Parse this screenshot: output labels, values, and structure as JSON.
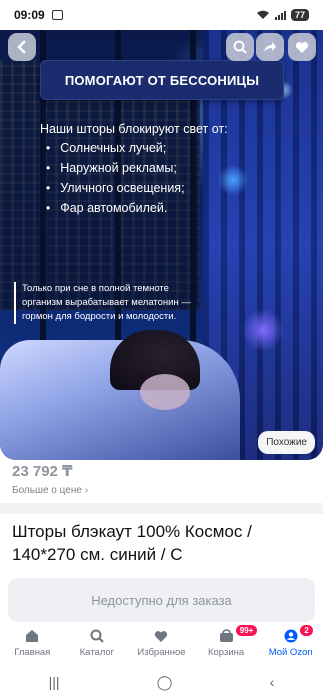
{
  "status_bar": {
    "time": "09:09",
    "battery": "77"
  },
  "hero": {
    "title": "ПОМОГАЮТ ОТ БЕССОНИЦЫ",
    "subtitle": "Наши шторы блокируют свет от:",
    "list": [
      "Солнечных лучей;",
      "Наружной рекламы;",
      "Уличного освещения;",
      "Фар автомобилей."
    ],
    "note": "Только при сне в полной темноте организм вырабатывает мелатонин — гормон для бодрости и молодости.",
    "similar_button": "Похожие"
  },
  "product": {
    "price": "23 792 ₸",
    "more_price": "Больше о цене",
    "title": "Шторы блэкаут 100% Космос / 140*270 см. синий / С"
  },
  "unavailable_button": "Недоступно для заказа",
  "bottom_nav": {
    "items": [
      {
        "label": "Главная",
        "icon": "home-icon"
      },
      {
        "label": "Каталог",
        "icon": "search-icon"
      },
      {
        "label": "Избранное",
        "icon": "heart-icon"
      },
      {
        "label": "Корзина",
        "icon": "cart-icon",
        "badge": "99+"
      },
      {
        "label": "Мой Ozon",
        "icon": "profile-icon",
        "badge": "2",
        "active": true
      }
    ]
  },
  "colors": {
    "accent": "#005bff",
    "badge": "#f91155"
  }
}
